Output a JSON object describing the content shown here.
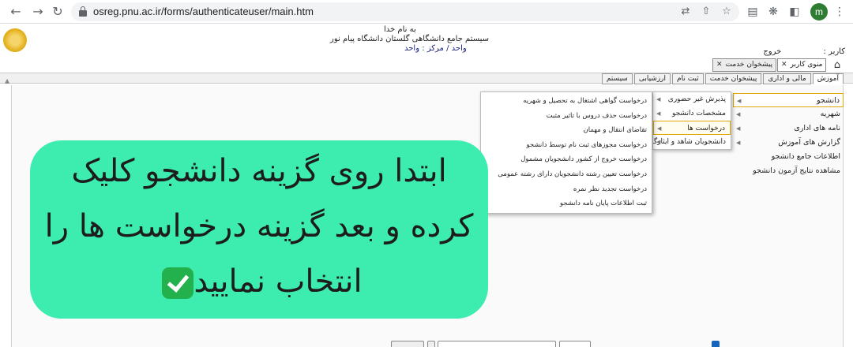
{
  "browser": {
    "url": "osreg.pnu.ac.ir/forms/authenticateuser/main.htm",
    "avatar_letter": "m"
  },
  "header": {
    "line1": "به نام خدا",
    "line2": "سیستم جامع دانشگاهی گلستان   دانشگاه پیام نور",
    "line3": "واحد / مرکز : واحد",
    "user_label": "کاربر :",
    "exit_label": "خروج"
  },
  "top_tabs": [
    {
      "label": "منوی کاربر"
    },
    {
      "label": "پیشخوان خدمت"
    }
  ],
  "menubar": [
    "آموزش",
    "مالی و اداری",
    "پیشخوان خدمت",
    "ثبت نام",
    "ارزشیابی",
    "سیستم"
  ],
  "menu_level1": [
    "دانشجو",
    "شهریه",
    "نامه های اداری",
    "گزارش های آموزش",
    "اطلاعات جامع دانشجو",
    "مشاهده نتایج آزمون دانشجو"
  ],
  "menu_level2": [
    "پذیرش غیر حضوری",
    "مشخصات دانشجو",
    "درخواست ها",
    "دانشجویان شاهد و ایثارگر"
  ],
  "menu_level3": [
    "درخواست گواهی اشتغال به تحصیل و شهریه",
    "درخواست حذف دروس با تاثیر مثبت",
    "تقاضای انتقال و مهمان",
    "درخواست مجوزهای ثبت نام توسط دانشجو",
    "درخواست خروج از کشور دانشجویان مشمول",
    "درخواست تعیین رشته دانشجویان دارای رشته عمومی",
    "درخواست تجدید نظر نمره",
    "ثبت اطلاعات پایان نامه دانشجو"
  ],
  "callout": {
    "line1": "ابتدا روی گزینه دانشجو کلیک",
    "line2": "کرده و بعد گزینه درخواست ها را",
    "line3": "انتخاب نمایید"
  },
  "colors": {
    "callout_bg": "#3dedb0",
    "selected_border": "#e0a800",
    "check": "#22b14c"
  }
}
